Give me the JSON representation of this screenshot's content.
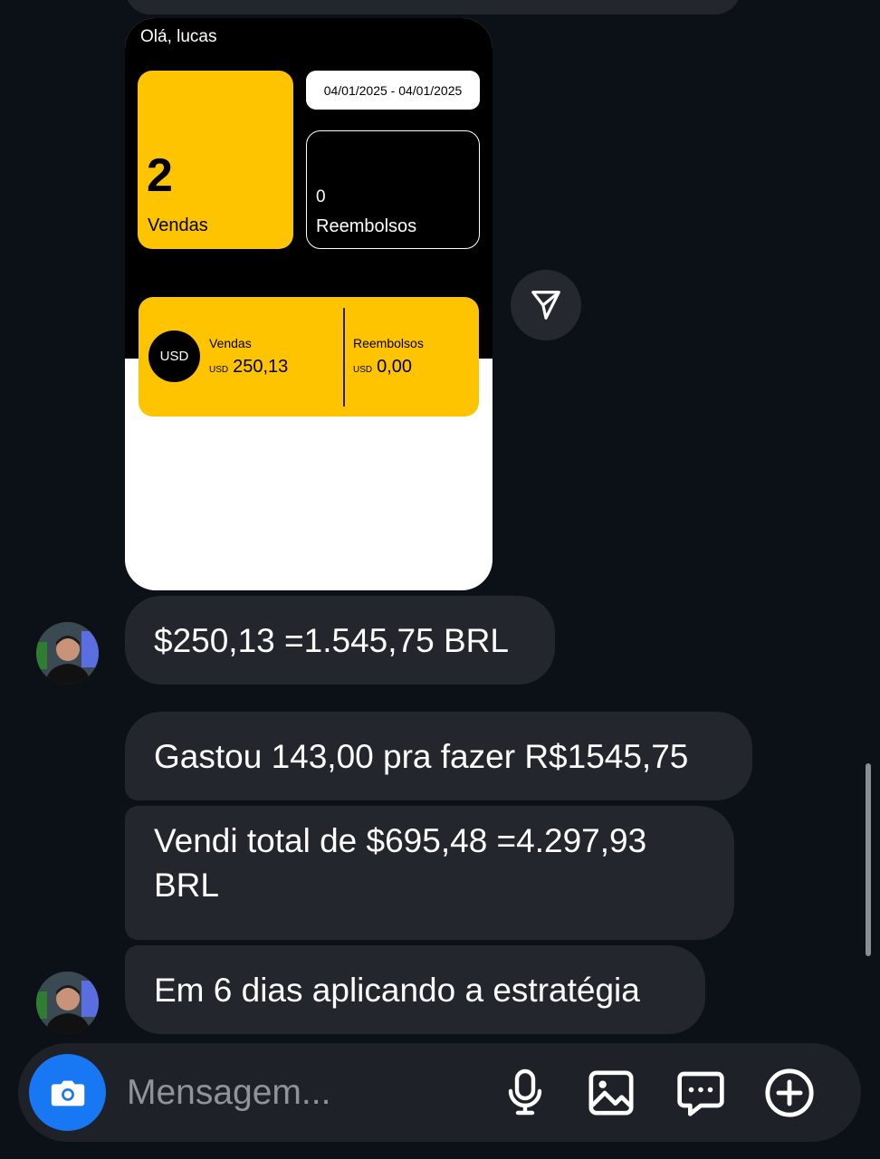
{
  "card": {
    "greeting": "Olá, lucas",
    "sales_count": "2",
    "sales_label": "Vendas",
    "date_range": "04/01/2025 - 04/01/2025",
    "refunds_count": "0",
    "refunds_label": "Reembolsos",
    "currency_badge": "USD",
    "summary": {
      "sales_label": "Vendas",
      "sales_currency": "USD",
      "sales_value": "250,13",
      "refunds_label": "Reembolsos",
      "refunds_currency": "USD",
      "refunds_value": "0,00"
    }
  },
  "messages": [
    {
      "text": "$250,13 =1.545,75 BRL"
    },
    {
      "text": "Gastou 143,00 pra fazer R$1545,75"
    },
    {
      "text": "Vendi total de $695,48 =4.297,93 BRL"
    },
    {
      "text": "Em 6 dias aplicando a estratégia"
    }
  ],
  "composer": {
    "placeholder": "Mensagem..."
  },
  "icons": {
    "forward": "send-icon",
    "camera": "camera-icon",
    "mic": "microphone-icon",
    "gallery": "image-icon",
    "sticker": "chat-bubble-icon",
    "more": "plus-circle-icon"
  },
  "colors": {
    "background": "#0c1017",
    "bubble": "#23262c",
    "accent_yellow": "#ffc400",
    "camera_blue": "#1877f2"
  }
}
